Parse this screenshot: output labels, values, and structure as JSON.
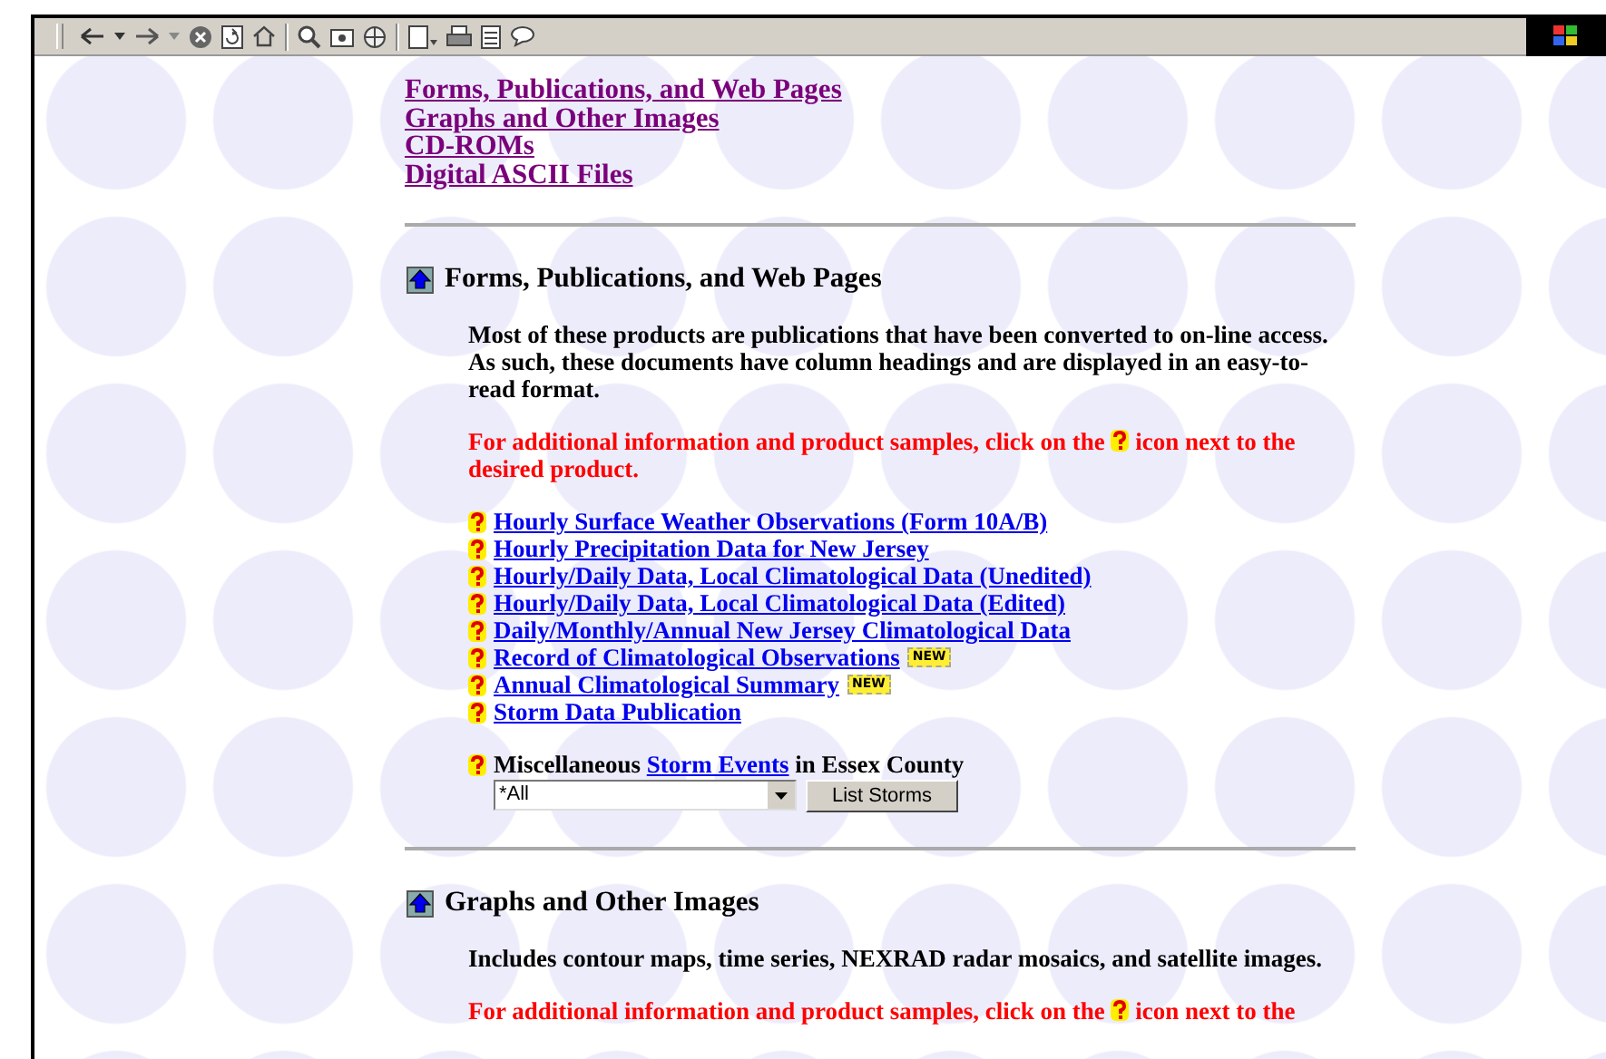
{
  "nav_links": [
    {
      "label": "Forms, Publications, and Web Pages",
      "visited": true
    },
    {
      "label": "Graphs and Other Images",
      "visited": true
    },
    {
      "label": "CD-ROMs",
      "visited": true
    },
    {
      "label": "Digital ASCII Files",
      "visited": true
    }
  ],
  "sections": [
    {
      "title": "Forms, Publications, and Web Pages",
      "description": "Most of these products are publications that have been converted to on-line access. As such, these documents have column headings and are displayed in an easy-to-read format.",
      "note_before": "For additional information and product samples, click on the",
      "note_after": "icon next to the desired product.",
      "products": [
        {
          "label": "Hourly Surface Weather Observations (Form 10A/B)"
        },
        {
          "label": "Hourly Precipitation Data for New Jersey"
        },
        {
          "label": "Hourly/Daily Data, Local Climatological Data (Unedited)"
        },
        {
          "label": "Hourly/Daily Data, Local Climatological Data (Edited)"
        },
        {
          "label": "Daily/Monthly/Annual New Jersey Climatological Data"
        },
        {
          "label": "Record of Climatological Observations",
          "badge": "NEW"
        },
        {
          "label": "Annual Climatological Summary",
          "badge": "NEW"
        },
        {
          "label": "Storm Data Publication"
        }
      ],
      "misc": {
        "prefix": "Miscellaneous",
        "link": "Storm Events",
        "suffix": "in Essex County",
        "select_value": "*All",
        "button": "List Storms"
      }
    },
    {
      "title": "Graphs and Other Images",
      "description": "Includes contour maps, time series, NEXRAD radar mosaics, and satellite images.",
      "note_before": "For additional information and product samples, click on the",
      "note_after": "icon next to the"
    }
  ]
}
